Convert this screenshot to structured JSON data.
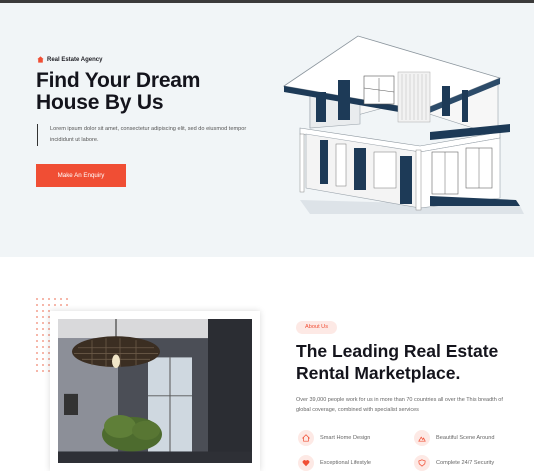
{
  "hero": {
    "tag": "Real Estate Agency",
    "title": "Find Your Dream House By Us",
    "description": "Lorem ipsum dolor sit amet, consectetur adipiscing elit, sed do eiusmod tempor incididunt ut labore.",
    "cta_label": "Make An Enquiry"
  },
  "about": {
    "pill": "About Us",
    "title": "The Leading Real Estate Rental Marketplace.",
    "description": "Over 39,000 people work for us in more than 70 countries all over the This breadth of global coverage, combined with specialist services",
    "features": [
      {
        "label": "Smart Home Design",
        "icon": "home-icon"
      },
      {
        "label": "Beautiful Scene Around",
        "icon": "scene-icon"
      },
      {
        "label": "Exceptional Lifestyle",
        "icon": "heart-icon"
      },
      {
        "label": "Complete 24/7 Security",
        "icon": "shield-icon"
      }
    ]
  },
  "colors": {
    "accent": "#f04e34",
    "dark": "#14141c",
    "hero_bg": "#f1f5f7",
    "house_roof": "#1d3a57"
  }
}
